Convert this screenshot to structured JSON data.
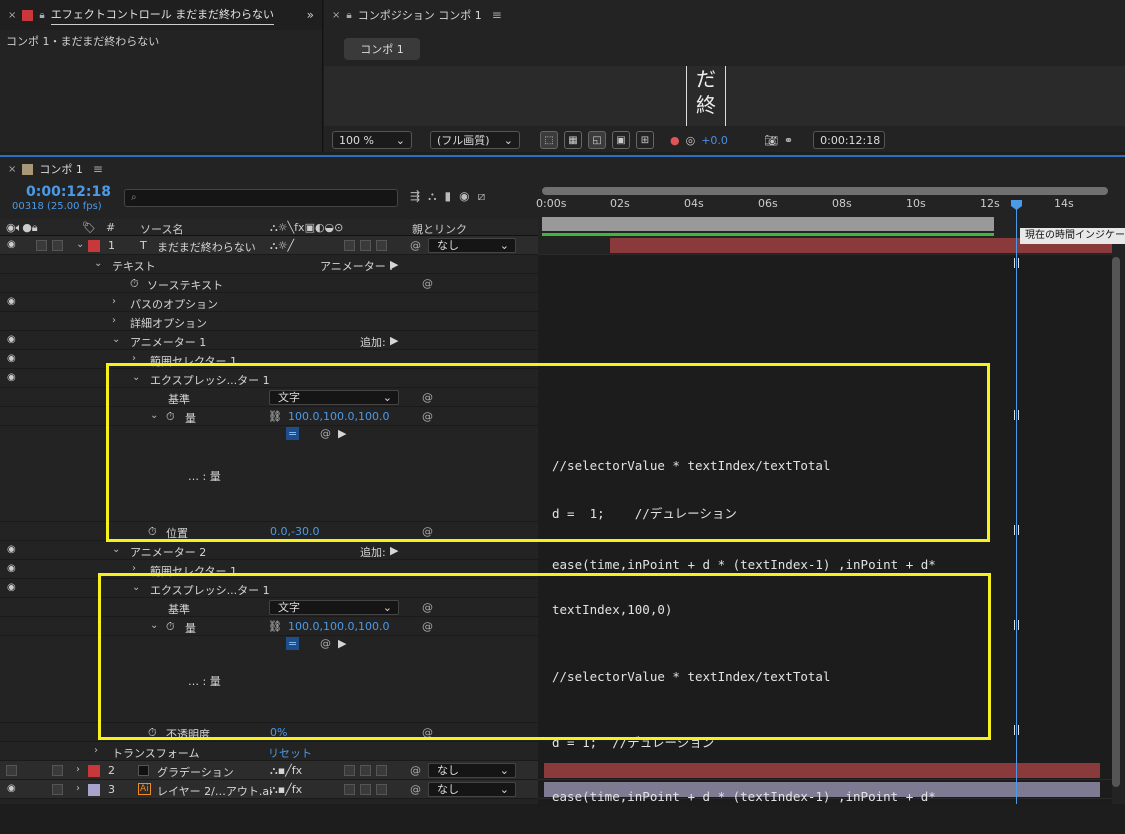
{
  "effect_panel": {
    "tab_title": "エフェクトコントロール まだまだ終わらない",
    "breadcrumb": "コンポ 1・まだまだ終わらない"
  },
  "comp_panel": {
    "tab_title": "コンポジション コンポ 1",
    "comp_tab": "コンポ 1",
    "viewer_text": [
      "だ",
      "終"
    ],
    "zoom": "100 %",
    "quality": "(フル画質)",
    "exposure": "+0.0",
    "timecode": "0:00:12:18"
  },
  "timeline": {
    "tab_title": "コンポ 1",
    "timecode": "0:00:12:18",
    "framecode": "00318 (25.00 fps)",
    "search_placeholder": "",
    "columns": {
      "num": "#",
      "source": "ソース名",
      "parent": "親とリンク"
    },
    "ruler": [
      "0:00s",
      "02s",
      "04s",
      "06s",
      "08s",
      "10s",
      "12s",
      "14s"
    ],
    "tooltip": "現在の時間インジケーター",
    "rows": {
      "layer1_num": "1",
      "layer1_name": "まだまだ終わらない",
      "layer1_parent": "なし",
      "text": "テキスト",
      "animator_label": "アニメーター :",
      "source_text": "ソーステキスト",
      "path_options": "パスのオプション",
      "more_options": "詳細オプション",
      "animator1": "アニメーター 1",
      "add_label1": "追加:",
      "range_selector1": "範囲セレクター 1",
      "expr_selector1": "エクスプレッシ...ター 1",
      "basis1": "基準",
      "basis1_value": "文字",
      "amount1": "量",
      "amount1_value": "100.0,100.0,100.0",
      "expr_amount1": "… : 量",
      "position": "位置",
      "position_value": "0.0,-30.0",
      "animator2": "アニメーター 2",
      "add_label2": "追加:",
      "range_selector2": "範囲セレクター 1",
      "expr_selector2": "エクスプレッシ...ター 1",
      "basis2": "基準",
      "basis2_value": "文字",
      "amount2": "量",
      "amount2_value": "100.0,100.0,100.0",
      "expr_amount2": "… : 量",
      "opacity": "不透明度",
      "opacity_value": "0%",
      "transform": "トランスフォーム",
      "reset": "リセット",
      "layer2_num": "2",
      "layer2_name": "グラデーション",
      "layer2_parent": "なし",
      "layer3_num": "3",
      "layer3_name": "レイヤー 2/…アウト.ai",
      "layer3_parent": "なし"
    },
    "code1": [
      "//selectorValue * textIndex/textTotal",
      "d =  1;    //デュレーション",
      "ease(time,inPoint + d * (textIndex-1) ,inPoint + d*",
      "textIndex,100,0)"
    ],
    "code2": [
      "//selectorValue * textIndex/textTotal",
      "d = 1;  //デュレーション",
      "ease(time,inPoint + d * (textIndex-1) ,inPoint + d*"
    ]
  },
  "colors": {
    "label_red": "#c8383a",
    "label_lavender": "#a8a4cc",
    "timecode_blue": "#4b9ae8",
    "highlight_yellow": "#f6f01e",
    "track_red": "#8a3a3a",
    "track_lavender": "#7d7a92"
  }
}
